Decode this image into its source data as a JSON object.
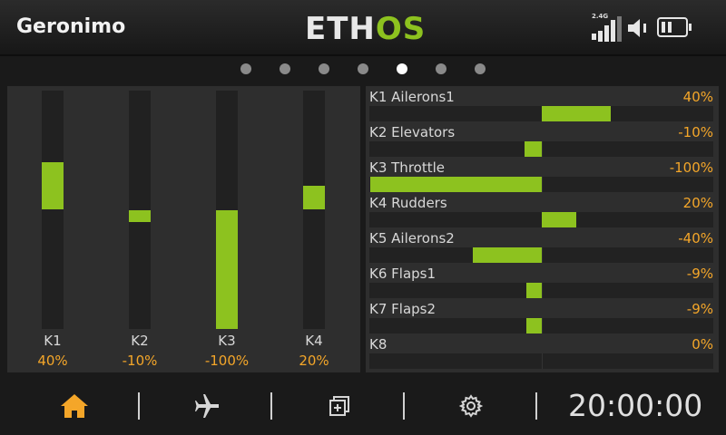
{
  "header": {
    "model_name": "Geronimo",
    "logo_main": "ETH",
    "logo_accent": "OS",
    "rssi_label": "2.4G"
  },
  "pager": {
    "count": 7,
    "active_index": 4
  },
  "colors": {
    "accent": "#8dc21f",
    "value": "#f4a629",
    "panel": "#2e2e2e"
  },
  "channel_bars": [
    {
      "label": "K1",
      "value_text": "40%",
      "value": 40
    },
    {
      "label": "K2",
      "value_text": "-10%",
      "value": -10
    },
    {
      "label": "K3",
      "value_text": "-100%",
      "value": -100
    },
    {
      "label": "K4",
      "value_text": "20%",
      "value": 20
    }
  ],
  "channels": [
    {
      "name": "K1 Ailerons1",
      "value_text": "40%",
      "value": 40
    },
    {
      "name": "K2 Elevators",
      "value_text": "-10%",
      "value": -10
    },
    {
      "name": "K3 Throttle",
      "value_text": "-100%",
      "value": -100
    },
    {
      "name": "K4 Rudders",
      "value_text": "20%",
      "value": 20
    },
    {
      "name": "K5 Ailerons2",
      "value_text": "-40%",
      "value": -40
    },
    {
      "name": "K6 Flaps1",
      "value_text": "-9%",
      "value": -9
    },
    {
      "name": "K7 Flaps2",
      "value_text": "-9%",
      "value": -9
    },
    {
      "name": "K8",
      "value_text": "0%",
      "value": 0
    }
  ],
  "nav": {
    "items": [
      {
        "name": "home",
        "icon": "home-icon",
        "active": true
      },
      {
        "name": "model",
        "icon": "airplane-icon",
        "active": false
      },
      {
        "name": "display",
        "icon": "screens-icon",
        "active": false
      },
      {
        "name": "settings",
        "icon": "gear-icon",
        "active": false
      }
    ],
    "clock": "20:00:00"
  }
}
